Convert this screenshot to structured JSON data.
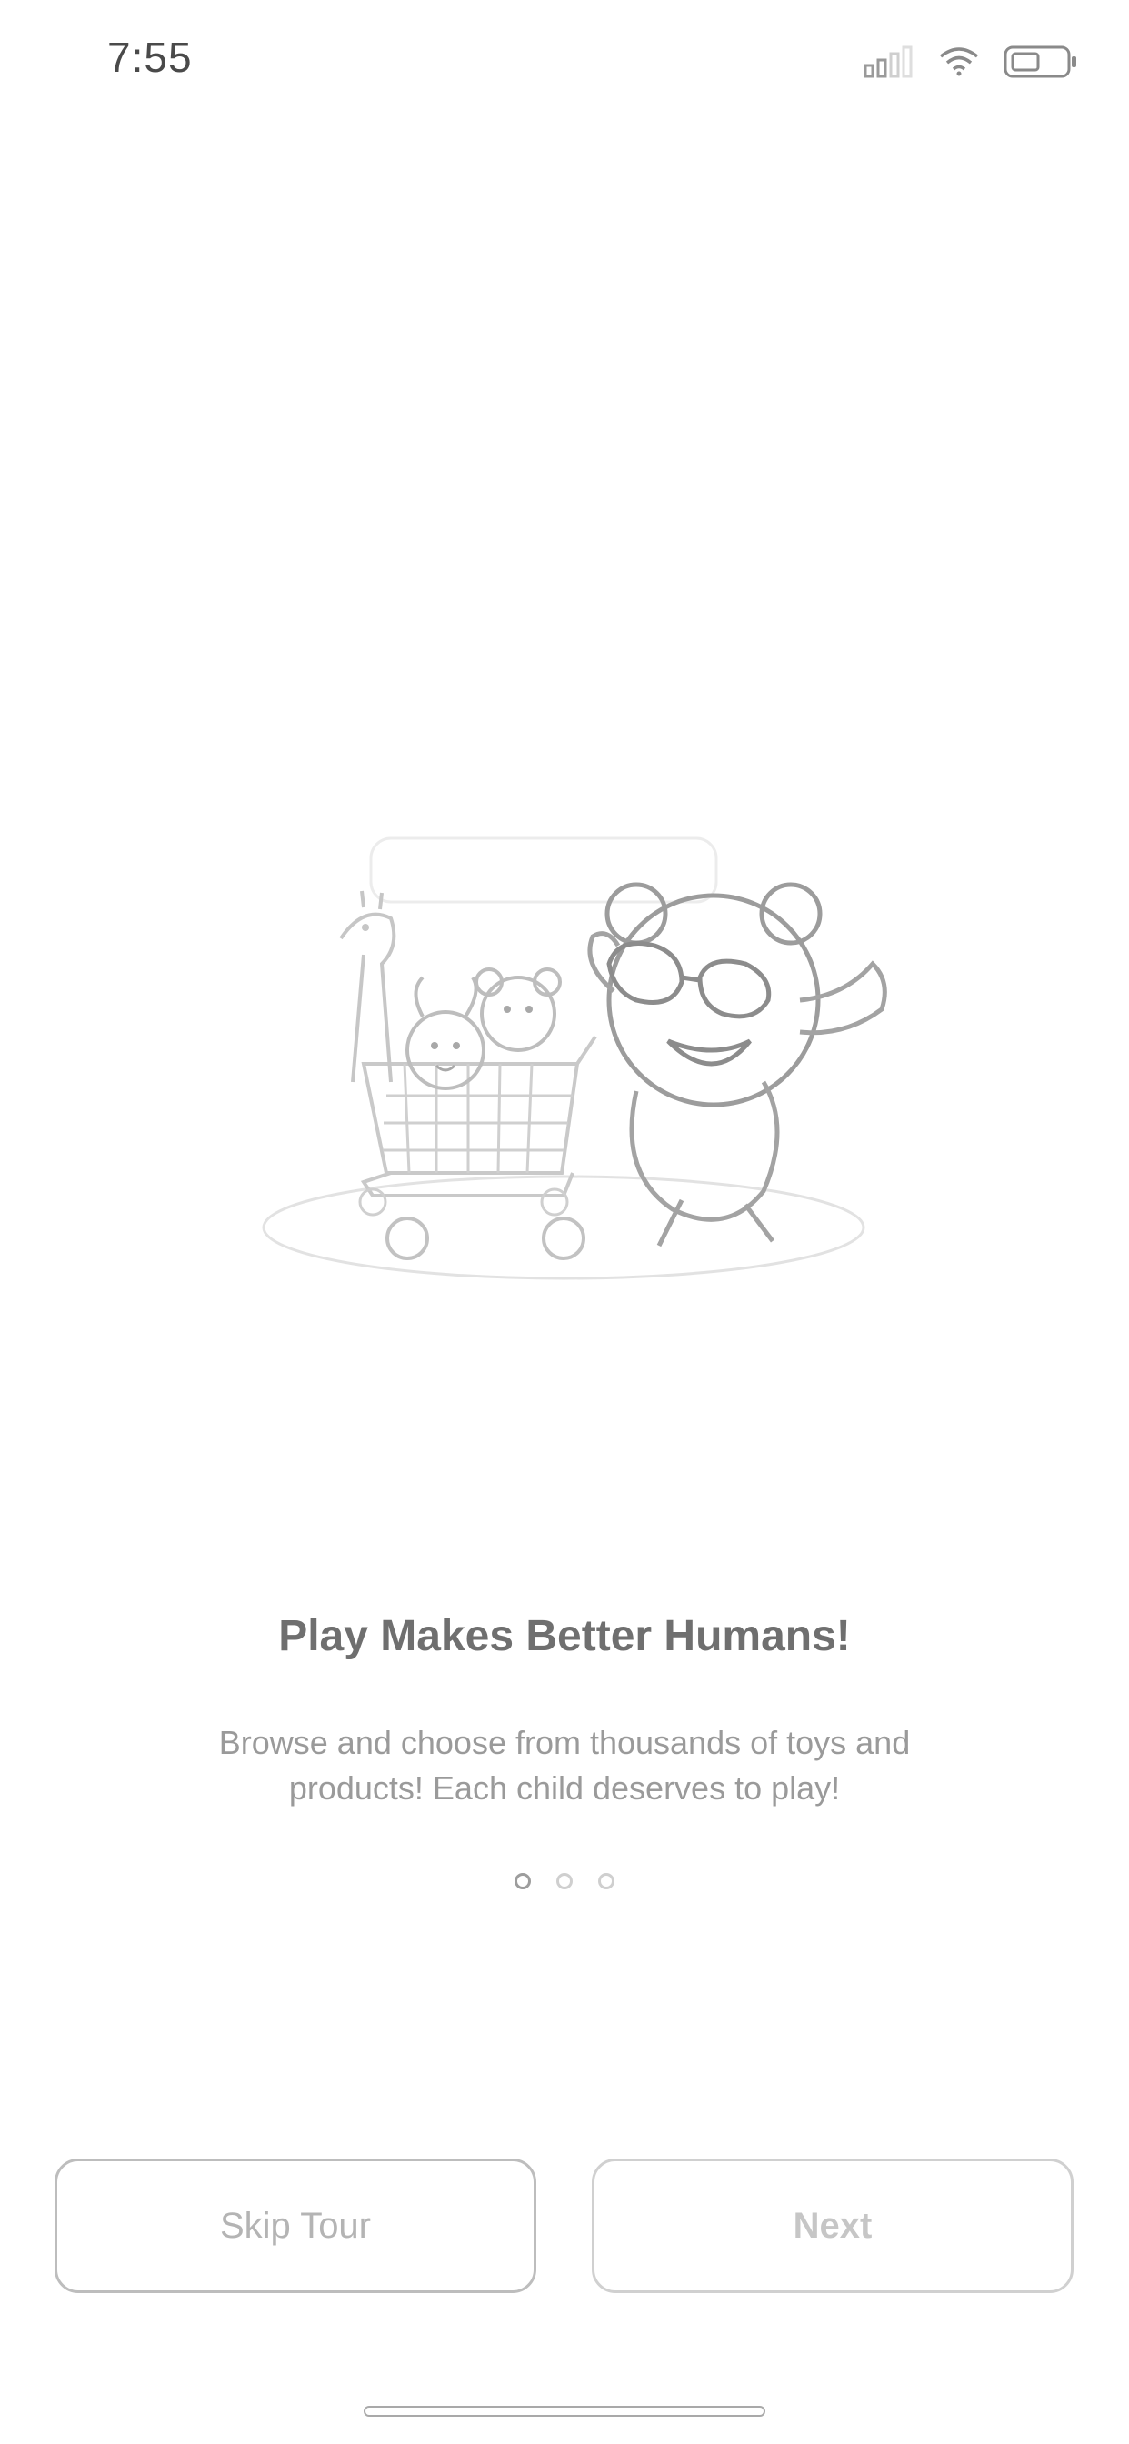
{
  "status_bar": {
    "time": "7:55",
    "icons": [
      "cellular-signal-icon",
      "wifi-icon",
      "battery-icon"
    ]
  },
  "onboarding": {
    "illustration": "bear-pushing-toy-cart-illustration",
    "title": "Play Makes Better Humans!",
    "subtitle": "Browse and choose from thousands of toys and products! Each child deserves to play!",
    "pager": {
      "total": 3,
      "current": 1
    }
  },
  "actions": {
    "skip_label": "Skip Tour",
    "next_label": "Next"
  },
  "colors": {
    "background": "#ffffff",
    "title": "#6f6f6f",
    "subtitle": "#9a9a9a",
    "button_border": "#bdbdbd"
  }
}
